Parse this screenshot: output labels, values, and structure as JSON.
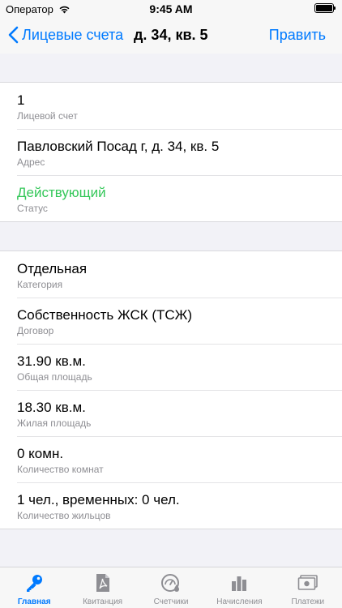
{
  "status_bar": {
    "carrier": "Оператор",
    "time": "9:45 AM"
  },
  "nav": {
    "back_label": "Лицевые счета",
    "title": "д. 34, кв. 5",
    "edit_label": "Править"
  },
  "section1": {
    "rows": [
      {
        "value": "1",
        "label": "Лицевой счет"
      },
      {
        "value": "Павловский Посад г, д. 34, кв. 5",
        "label": "Адрес"
      },
      {
        "value": "Действующий",
        "label": "Статус"
      }
    ]
  },
  "section2": {
    "rows": [
      {
        "value": "Отдельная",
        "label": "Категория"
      },
      {
        "value": "Собственность ЖСК (ТСЖ)",
        "label": "Договор"
      },
      {
        "value": "31.90 кв.м.",
        "label": "Общая площадь"
      },
      {
        "value": "18.30 кв.м.",
        "label": "Жилая площадь"
      },
      {
        "value": "0 комн.",
        "label": "Количество комнат"
      },
      {
        "value": "1 чел., временных: 0 чел.",
        "label": "Количество жильцов"
      }
    ]
  },
  "tabs": [
    {
      "label": "Главная",
      "icon": "key-icon"
    },
    {
      "label": "Квитанция",
      "icon": "pdf-document-icon"
    },
    {
      "label": "Счетчики",
      "icon": "meter-icon"
    },
    {
      "label": "Начисления",
      "icon": "bar-chart-icon"
    },
    {
      "label": "Платежи",
      "icon": "banknote-icon"
    }
  ],
  "colors": {
    "accent": "#007aff",
    "status_active": "#34c759",
    "secondary_text": "#8e8e93"
  }
}
